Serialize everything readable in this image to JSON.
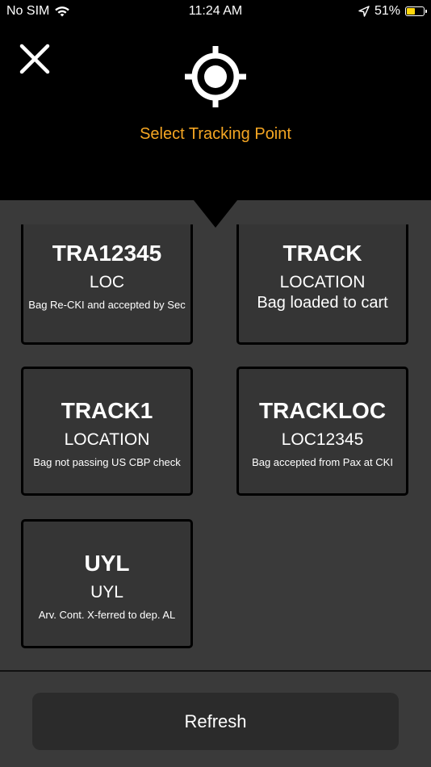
{
  "status_bar": {
    "carrier": "No SIM",
    "time": "11:24 AM",
    "battery": "51%",
    "battery_level": 0.51,
    "icons": [
      "wifi-icon",
      "location-arrow-icon",
      "battery-icon"
    ]
  },
  "header": {
    "title": "Select Tracking Point",
    "title_color": "#f5a623",
    "icons": [
      "close-icon",
      "crosshair-target-icon"
    ]
  },
  "tiles": [
    {
      "code": "TRA12345",
      "location": "LOC",
      "description": "Bag Re-CKI and accepted by Sec"
    },
    {
      "code": "TRACK",
      "location": "LOCATION",
      "description": "Bag loaded to cart"
    },
    {
      "code": "TRACK1",
      "location": "LOCATION",
      "description": "Bag not passing US CBP check"
    },
    {
      "code": "TRACKLOC",
      "location": "LOC12345",
      "description": "Bag accepted from Pax at CKI"
    },
    {
      "code": "UYL",
      "location": "UYL",
      "description": "Arv. Cont. X-ferred to dep. AL"
    }
  ],
  "footer": {
    "refresh_label": "Refresh"
  }
}
